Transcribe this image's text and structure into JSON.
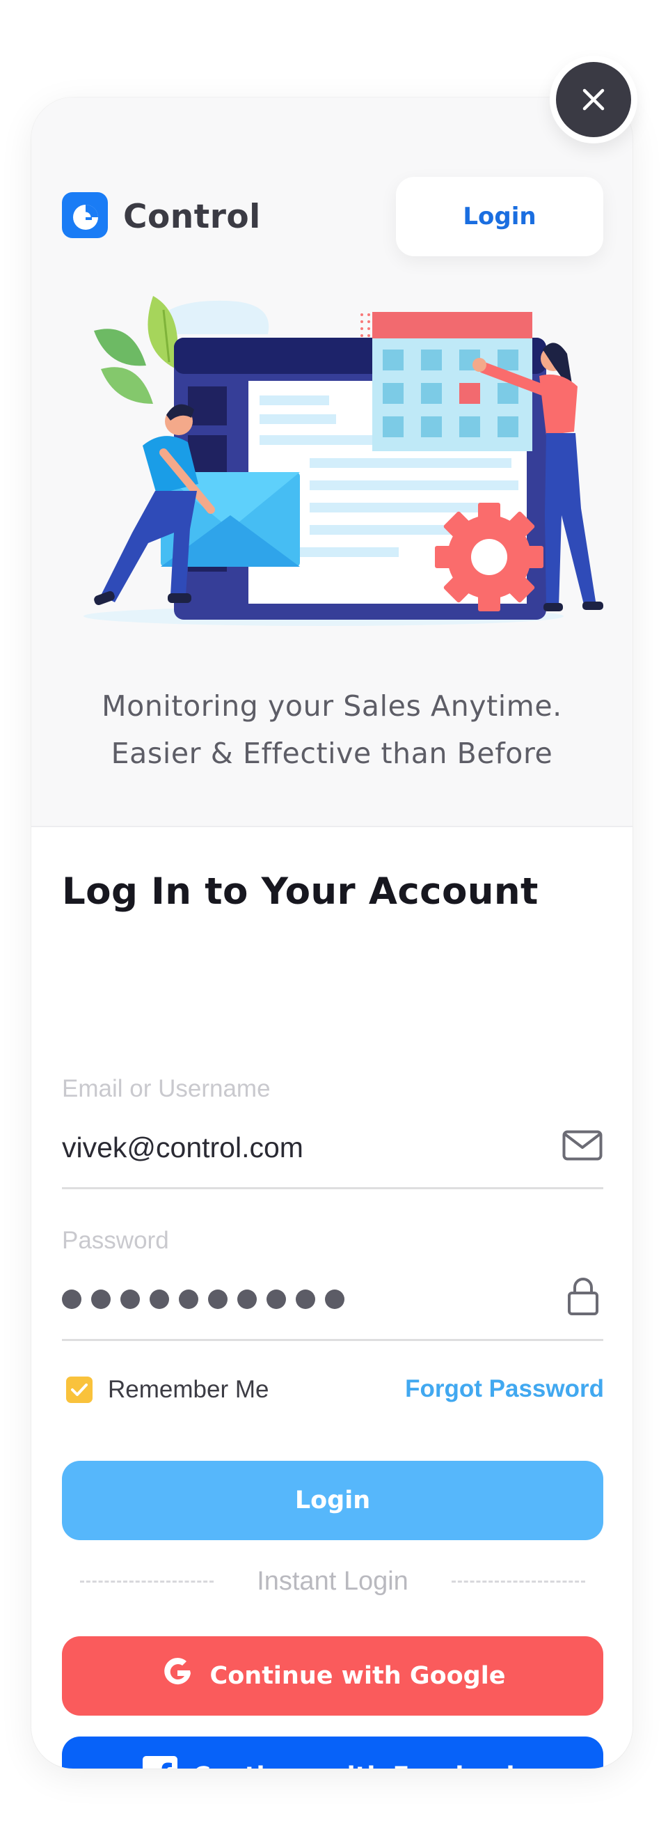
{
  "header": {
    "app_name": "Control",
    "login_button": "Login",
    "close_icon": "close-icon",
    "logo_icon": "control-logo-icon"
  },
  "hero": {
    "line1": "Monitoring your Sales Anytime.",
    "line2": "Easier & Effective than Before"
  },
  "form": {
    "title": "Log In to Your Account",
    "email_label": "Email or Username",
    "email_value": "vivek@control.com",
    "email_icon": "mail-icon",
    "password_label": "Password",
    "password_mask_count": 10,
    "password_icon": "lock-icon",
    "remember_label": "Remember Me",
    "remember_checked": true,
    "forgot_label": "Forgot Password",
    "login_button": "Login"
  },
  "instant": {
    "divider_label": "Instant Login",
    "google_button": "Continue with Google",
    "facebook_button": "Continue with Facebook"
  },
  "colors": {
    "primary_blue": "#1a6ee0",
    "login_button": "#56b7fb",
    "google": "#fa5b5c",
    "facebook": "#0762f9",
    "checkbox": "#f9c23c",
    "close_button": "#3a3a44"
  }
}
